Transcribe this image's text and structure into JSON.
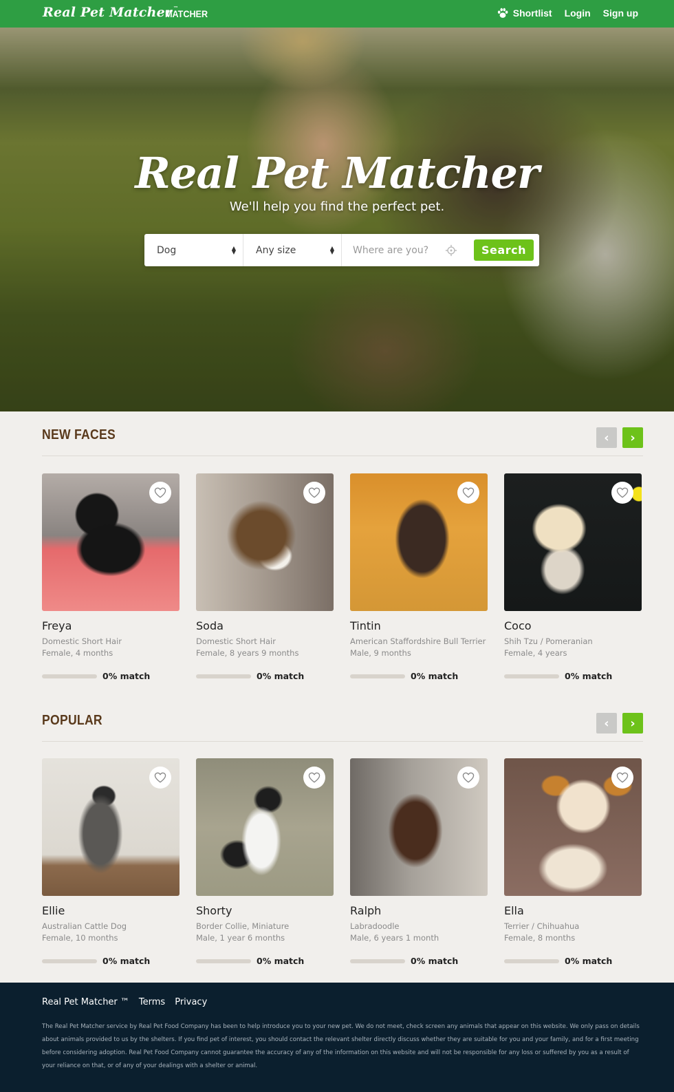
{
  "nav": {
    "brand": "Real Pet Matcher",
    "brand_tm": "™",
    "matcher": "MATCHER",
    "shortlist": "Shortlist",
    "login": "Login",
    "signup": "Sign up"
  },
  "hero": {
    "title": "Real Pet Matcher",
    "subtitle": "We'll help you find the perfect pet.",
    "search": {
      "species": "Dog",
      "size": "Any size",
      "location_placeholder": "Where are you?",
      "button": "Search"
    }
  },
  "sections": [
    {
      "title": "NEW FACES",
      "pets": [
        {
          "name": "Freya",
          "breed": "Domestic Short Hair",
          "info": "Female, 4 months",
          "match": "0% match",
          "match_value": 0
        },
        {
          "name": "Soda",
          "breed": "Domestic Short Hair",
          "info": "Female, 8 years 9 months",
          "match": "0% match",
          "match_value": 0
        },
        {
          "name": "Tintin",
          "breed": "American Staffordshire Bull Terrier",
          "info": "Male, 9 months",
          "match": "0% match",
          "match_value": 0
        },
        {
          "name": "Coco",
          "breed": "Shih Tzu / Pomeranian",
          "info": "Female, 4 years",
          "match": "0% match",
          "match_value": 0
        }
      ]
    },
    {
      "title": "POPULAR",
      "pets": [
        {
          "name": "Ellie",
          "breed": "Australian Cattle Dog",
          "info": "Female, 10 months",
          "match": "0% match",
          "match_value": 0
        },
        {
          "name": "Shorty",
          "breed": "Border Collie, Miniature",
          "info": "Male, 1 year 6 months",
          "match": "0% match",
          "match_value": 0
        },
        {
          "name": "Ralph",
          "breed": "Labradoodle",
          "info": "Male, 6 years 1 month",
          "match": "0% match",
          "match_value": 0
        },
        {
          "name": "Ella",
          "breed": "Terrier / Chihuahua",
          "info": "Female, 8 months",
          "match": "0% match",
          "match_value": 0
        }
      ]
    }
  ],
  "footer": {
    "brand": "Real Pet Matcher ™",
    "terms": "Terms",
    "privacy": "Privacy",
    "disclaimer": "The Real Pet Matcher service by Real Pet Food Company has been to help introduce you to your new pet. We do not meet, check screen any animals that appear on this website. We only pass on details about animals provided to us by the shelters. If you find pet of interest, you should contact the relevant shelter directly discuss whether they are suitable for you and your family, and for a first meeting before considering adoption. Real Pet Food Company cannot guarantee the accuracy of any of the information on this website and will not be responsible for any loss or suffered by you as a result of your reliance on that, or of any of your dealings with a shelter or animal."
  },
  "colors": {
    "nav_green": "#2e9e43",
    "accent_green": "#6dc21a",
    "section_title": "#5a3a1c",
    "footer_bg": "#0b1f2e"
  },
  "icons": [
    "paw-icon",
    "target-icon",
    "heart-icon",
    "chevron-left-icon",
    "chevron-right-icon"
  ]
}
